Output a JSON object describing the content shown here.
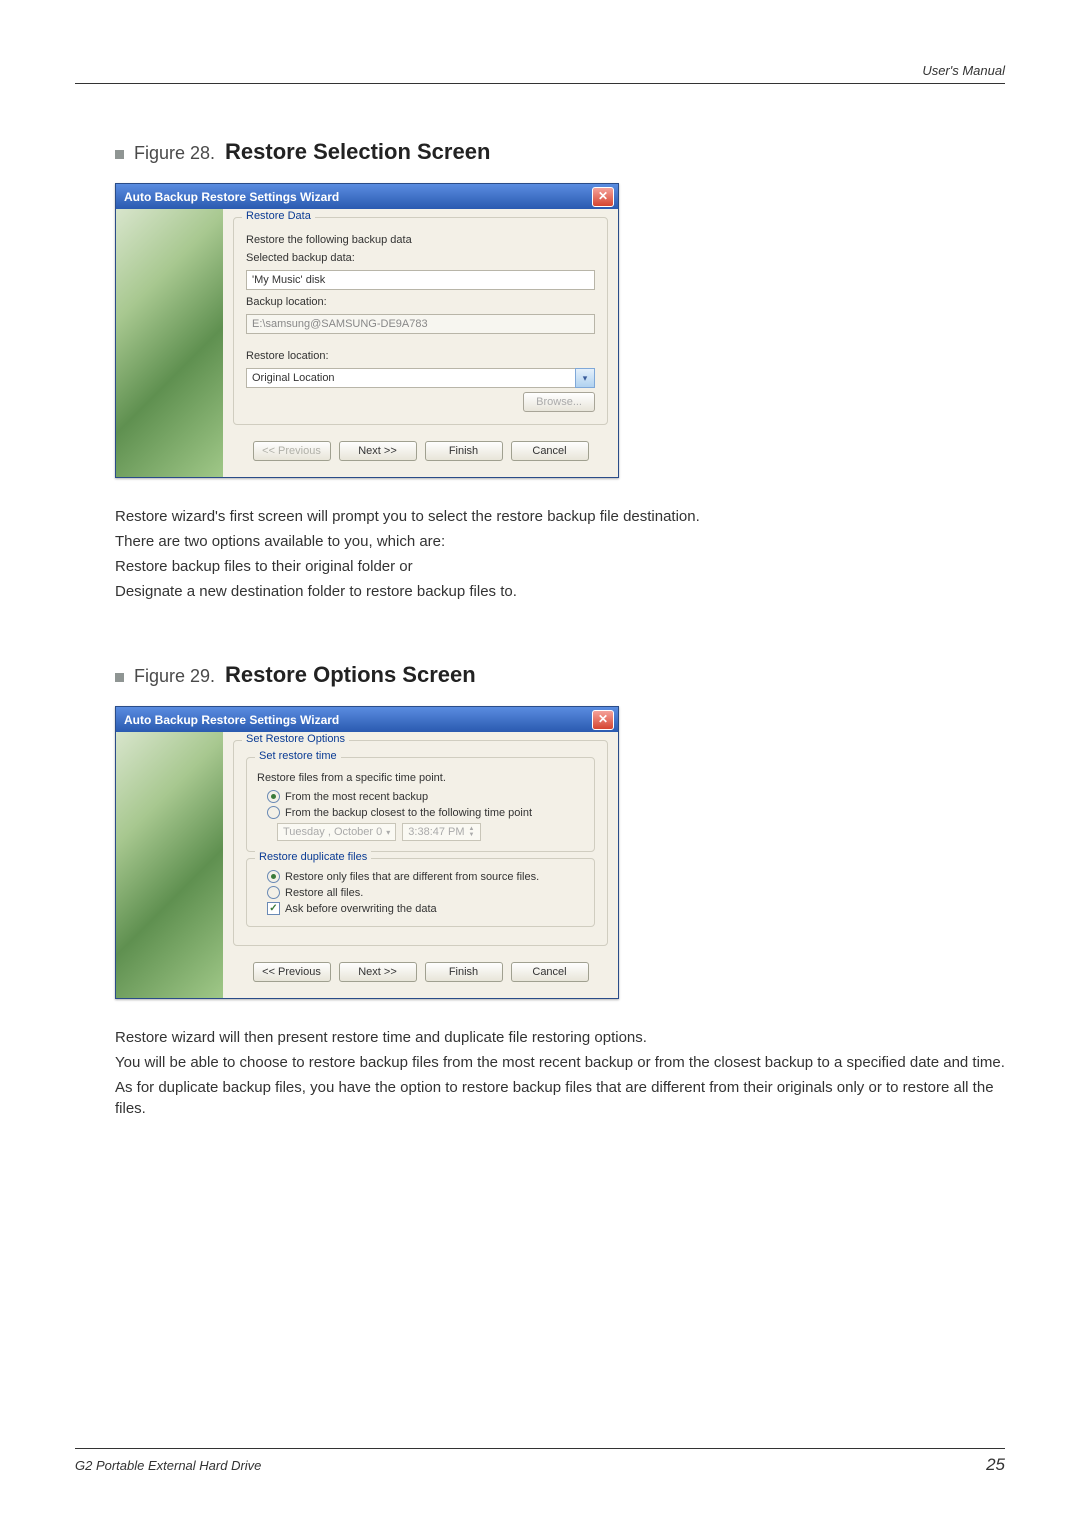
{
  "header": {
    "manual": "User's Manual"
  },
  "fig1": {
    "label": "Figure 28.",
    "title": "Restore Selection Screen",
    "wizard_title": "Auto Backup Restore Settings Wizard",
    "legend": "Restore Data",
    "line1": "Restore the following backup data",
    "line2": "Selected backup data:",
    "selected_value": "'My Music' disk",
    "line3": "Backup location:",
    "backup_value": "E:\\samsung@SAMSUNG-DE9A783",
    "line4": "Restore location:",
    "restore_value": "Original Location",
    "browse": "Browse...",
    "prev": "<< Previous",
    "next": "Next >>",
    "finish": "Finish",
    "cancel": "Cancel"
  },
  "para1": {
    "l1": "Restore wizard's first screen will prompt you to select the restore backup file destination.",
    "l2": "There are two options available to you, which are:",
    "l3": "Restore backup files to their original folder or",
    "l4": "Designate a new destination folder to restore backup files to."
  },
  "fig2": {
    "label": "Figure 29.",
    "title": "Restore Options Screen",
    "wizard_title": "Auto Backup Restore Settings Wizard",
    "legend": "Set Restore Options",
    "sub1_legend": "Set restore time",
    "sub1_line": "Restore files from a specific time point.",
    "opt1": "From the most recent backup",
    "opt2": "From the backup closest to the following time point",
    "date_text": "Tuesday ,   October   0",
    "time_text": "3:38:47 PM",
    "sub2_legend": "Restore duplicate files",
    "opt3": "Restore only files that are different from source files.",
    "opt4": "Restore all files.",
    "check": "Ask before overwriting the data",
    "prev": "<< Previous",
    "next": "Next >>",
    "finish": "Finish",
    "cancel": "Cancel"
  },
  "para2": {
    "l1": "Restore wizard will then present restore time and duplicate file restoring options.",
    "l2": "You will be able to choose to restore backup files from the most recent backup or from the closest backup to a specified date and time.",
    "l3": "As for duplicate backup files, you have the option to restore backup files that are different from their originals only or to restore all the files."
  },
  "footer": {
    "product": "G2 Portable External Hard Drive",
    "page": "25"
  }
}
